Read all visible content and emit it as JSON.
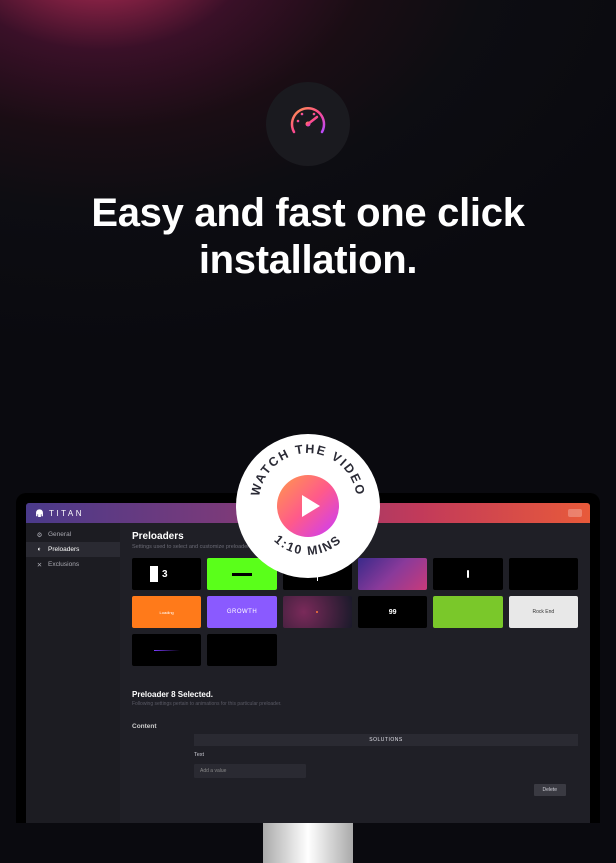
{
  "hero": {
    "headline_line1": "Easy and fast one click",
    "headline_line2": "installation."
  },
  "play_badge": {
    "text_top": "WATCH THE VIDEO",
    "text_bottom": "1:10 MINS"
  },
  "app": {
    "brand": "TITAN",
    "sidebar": {
      "items": [
        {
          "label": "General",
          "icon": "gear-icon"
        },
        {
          "label": "Preloaders",
          "icon": "preloader-icon"
        },
        {
          "label": "Exclusions",
          "icon": "x-icon"
        }
      ]
    },
    "main": {
      "title": "Preloaders",
      "subtitle": "Settings used to select and customize preloaders.",
      "tiles": [
        {
          "label": "3"
        },
        {
          "label": ""
        },
        {
          "label": ""
        },
        {
          "label": ""
        },
        {
          "label": ""
        },
        {
          "label": ""
        },
        {
          "label": "Loading"
        },
        {
          "label": "GROWTH"
        },
        {
          "label": ""
        },
        {
          "label": "99"
        },
        {
          "label": ""
        },
        {
          "label": "Rock End"
        },
        {
          "label": ""
        },
        {
          "label": ""
        }
      ],
      "selected": {
        "title": "Preloader 8 Selected.",
        "desc": "Following settings pertain to animations for this particular preloader."
      },
      "content": {
        "label": "Content",
        "solutions_label": "SOLUTIONS",
        "text_label": "Text",
        "text_placeholder": "Add a value",
        "delete_label": "Delete"
      }
    }
  }
}
